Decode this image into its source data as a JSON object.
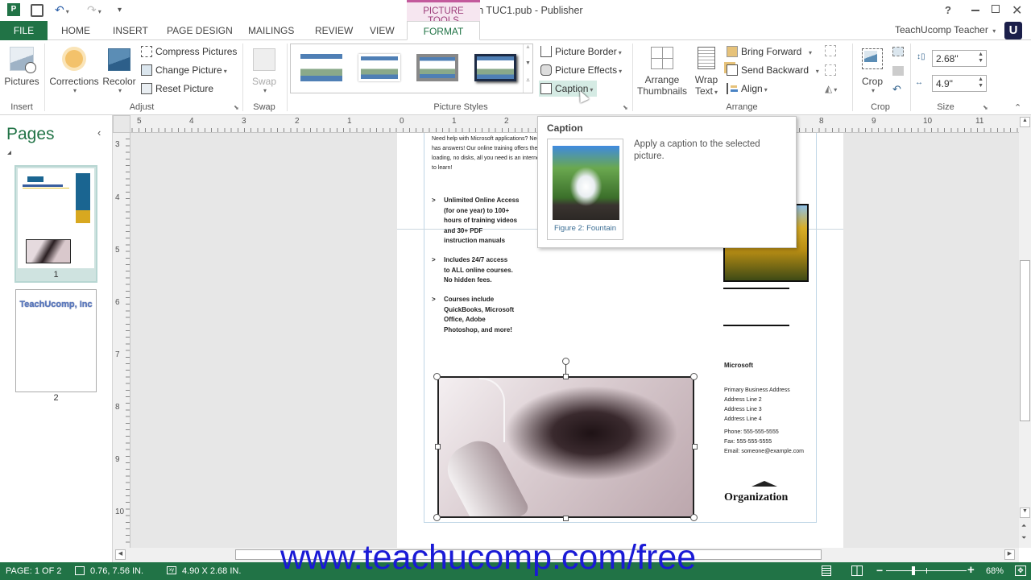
{
  "window": {
    "title": "Coupon TUC1.pub - Publisher",
    "context_tab_group": "PICTURE TOOLS",
    "help": "?",
    "user": "TeachUcomp Teacher",
    "user_avatar_letter": "U"
  },
  "tabs": [
    {
      "label": "FILE"
    },
    {
      "label": "HOME"
    },
    {
      "label": "INSERT"
    },
    {
      "label": "PAGE DESIGN"
    },
    {
      "label": "MAILINGS"
    },
    {
      "label": "REVIEW"
    },
    {
      "label": "VIEW"
    },
    {
      "label": "FORMAT",
      "active": true
    }
  ],
  "ribbon": {
    "insert": {
      "label": "Insert",
      "pictures": "Pictures"
    },
    "adjust": {
      "label": "Adjust",
      "corrections": "Corrections",
      "recolor": "Recolor",
      "compress": "Compress Pictures",
      "change": "Change Picture",
      "reset": "Reset Picture"
    },
    "swap": {
      "label": "Swap",
      "swap": "Swap"
    },
    "picture_styles": {
      "label": "Picture Styles",
      "border": "Picture Border",
      "effects": "Picture Effects",
      "caption": "Caption"
    },
    "arrange": {
      "label": "Arrange",
      "arrange_thumbnails_1": "Arrange",
      "arrange_thumbnails_2": "Thumbnails",
      "wrap_1": "Wrap",
      "wrap_2": "Text",
      "bring_forward": "Bring Forward",
      "send_backward": "Send Backward",
      "align": "Align"
    },
    "crop": {
      "label": "Crop",
      "crop": "Crop"
    },
    "size": {
      "label": "Size",
      "height": "2.68\"",
      "width": "4.9\""
    }
  },
  "tooltip": {
    "title": "Caption",
    "description": "Apply a caption to the selected picture.",
    "preview_caption": "Figure 2: Fountain"
  },
  "pages_panel": {
    "title": "Pages",
    "pages": [
      {
        "number": "1",
        "selected": true
      },
      {
        "number": "2",
        "thumb_text": "TeachUcomp, Inc"
      }
    ]
  },
  "rulers": {
    "horizontal": [
      "5",
      "4",
      "3",
      "2",
      "1",
      "0",
      "1",
      "2",
      "8",
      "9",
      "10",
      "11"
    ],
    "vertical": [
      "3",
      "4",
      "5",
      "6",
      "7",
      "8",
      "9",
      "10"
    ]
  },
  "document": {
    "intro_lines": [
      "Need help with Microsoft applications? Need",
      "has answers! Our online training offers the",
      "loading, no disks, all you need is an internet",
      "to learn!"
    ],
    "bullets": [
      {
        "marker": ">",
        "lines": [
          "Unlimited Online Access",
          "(for one year) to 100+",
          "hours of training videos",
          "and 30+ PDF",
          "instruction manuals"
        ]
      },
      {
        "marker": ">",
        "lines": [
          "Includes 24/7 access",
          "to ALL online courses.",
          "No hidden fees."
        ]
      },
      {
        "marker": ">",
        "lines": [
          "Courses include",
          "QuickBooks, Microsoft",
          "Office, Adobe",
          "Photoshop, and more!"
        ]
      }
    ],
    "company": "Microsoft",
    "address": [
      "Primary Business Address",
      "Address Line 2",
      "Address Line 3",
      "Address Line 4"
    ],
    "contact": [
      "Phone: 555-555-5555",
      "Fax: 555-555-5555",
      "Email: someone@example.com"
    ],
    "organization": "Organization"
  },
  "status": {
    "page": "PAGE: 1 OF 2",
    "position": "0.76, 7.56 IN.",
    "size": "4.90 X 2.68 IN.",
    "zoom": "68%",
    "zoom_fraction": 0.68
  },
  "watermark": "www.teachucomp.com/free",
  "colors": {
    "accent": "#217346",
    "context_tab": "#c35a9c",
    "caption_hover": "#d5ebe4",
    "sidebar_blue": "#1a6591"
  }
}
